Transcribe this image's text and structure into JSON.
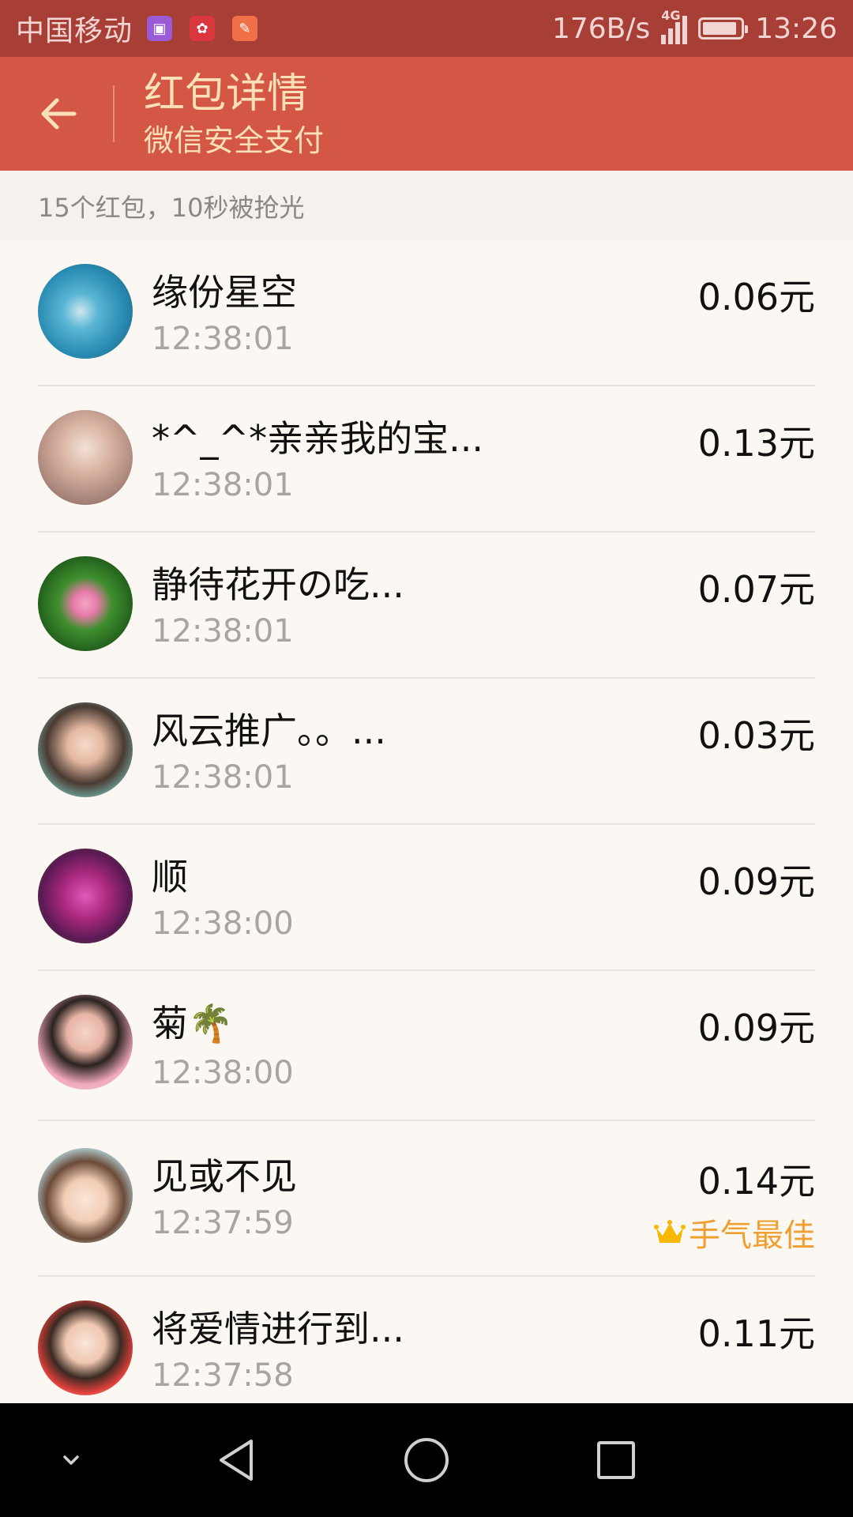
{
  "status_bar": {
    "carrier": "中国移动",
    "net_speed": "176B/s",
    "network": "4G",
    "time": "13:26",
    "battery_level": 0.9
  },
  "header": {
    "title": "红包详情",
    "subtitle": "微信安全支付"
  },
  "summary": "15个红包，10秒被抢光",
  "list": [
    {
      "name": "缘份星空",
      "time": "12:38:01",
      "amount": "0.06元"
    },
    {
      "name": "*^_^*亲亲我的宝...",
      "time": "12:38:01",
      "amount": "0.13元"
    },
    {
      "name": "静待花开の吃...",
      "time": "12:38:01",
      "amount": "0.07元"
    },
    {
      "name": "风云推广。。...",
      "time": "12:38:01",
      "amount": "0.03元"
    },
    {
      "name": "顺",
      "time": "12:38:00",
      "amount": "0.09元"
    },
    {
      "name": "菊🌴",
      "time": "12:38:00",
      "amount": "0.09元"
    },
    {
      "name": "见或不见",
      "time": "12:37:59",
      "amount": "0.14元",
      "best_label": "手气最佳"
    },
    {
      "name": "将爱情进行到...",
      "time": "12:37:58",
      "amount": "0.11元"
    }
  ],
  "colors": {
    "status_bar": "#a83f37",
    "header": "#d45746",
    "header_text": "#fbe0b8",
    "best_label": "#f0a030"
  }
}
